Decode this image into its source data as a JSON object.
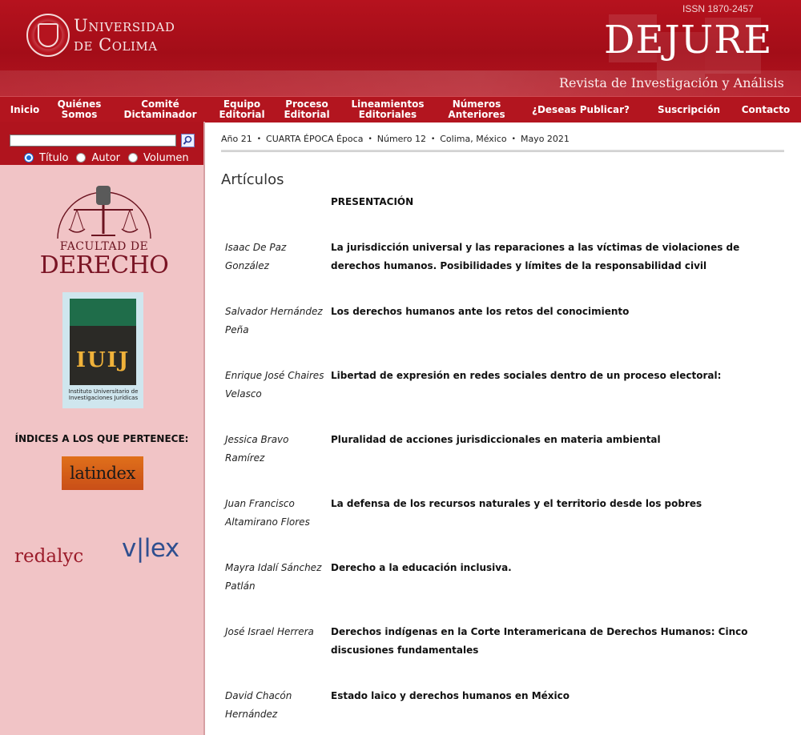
{
  "header": {
    "university": "Universidad de Colima",
    "university_line1": "Universidad",
    "university_line2": "de Colima",
    "issn": "ISSN 1870-2457",
    "journal": "DEJURE",
    "subtitle": "Revista de Investigación y Análisis"
  },
  "nav": {
    "items": [
      {
        "label": "Inicio"
      },
      {
        "label": "Quiénes\nSomos"
      },
      {
        "label": "Comité\nDictaminador"
      },
      {
        "label": "Equipo\nEditorial"
      },
      {
        "label": "Proceso\nEditorial"
      },
      {
        "label": "Lineamientos\nEditoriales"
      },
      {
        "label": "Números\nAnteriores"
      },
      {
        "label": "¿Deseas Publicar?"
      },
      {
        "label": "Suscripción"
      },
      {
        "label": "Contacto"
      }
    ]
  },
  "search": {
    "value": "",
    "radios": [
      {
        "label": "Título",
        "checked": true
      },
      {
        "label": "Autor",
        "checked": false
      },
      {
        "label": "Volumen",
        "checked": false
      }
    ]
  },
  "sidebar": {
    "faculty_line1": "FACULTAD DE",
    "faculty_line2": "DERECHO",
    "iuij_letters": "IUIJ",
    "iuij_caption": "Instituto Universitario de Investigaciones Jurídicas",
    "indices_heading": "ÍNDICES A LOS QUE PERTENECE:",
    "latindex": "latindex",
    "redalyc": "redalyc",
    "vlex": "v|lex"
  },
  "issue": {
    "year": "Año 21",
    "epoch": "CUARTA ÉPOCA Época",
    "number": "Número 12",
    "place": "Colima, México",
    "date": "Mayo 2021"
  },
  "main": {
    "section_title": "Artículos",
    "presentation": "PRESENTACIÓN",
    "articles": [
      {
        "author": "Isaac De Paz González",
        "title": "La jurisdicción universal y las reparaciones a las víctimas de violaciones de derechos humanos. Posibilidades y límites de la responsabilidad civil"
      },
      {
        "author": "Salvador Hernández Peña",
        "title": "Los derechos humanos ante los retos del conocimiento"
      },
      {
        "author": "Enrique José Chaires Velasco",
        "title": "Libertad de expresión en redes sociales dentro de un proceso electoral:"
      },
      {
        "author": "Jessica Bravo Ramírez",
        "title": "Pluralidad de acciones jurisdiccionales en materia ambiental"
      },
      {
        "author": "Juan Francisco Altamirano Flores",
        "title": "La defensa de los recursos naturales y el territorio desde los pobres"
      },
      {
        "author": "Mayra Idalí Sánchez Patlán",
        "title": "Derecho a la educación inclusiva."
      },
      {
        "author": "José Israel Herrera",
        "title": "Derechos indígenas en la Corte Interamericana de Derechos Humanos: Cinco discusiones fundamentales"
      },
      {
        "author": "David Chacón Hernández",
        "title": "Estado laico y derechos humanos en México"
      }
    ]
  },
  "colors": {
    "brand_red": "#b3151f",
    "sidebar_pink": "#f1c4c6",
    "faculty_maroon": "#7a1424"
  }
}
